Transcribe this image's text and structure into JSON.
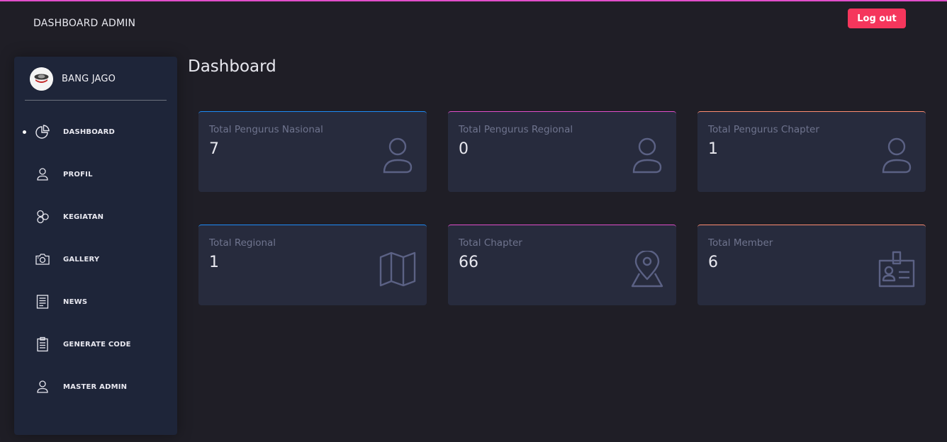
{
  "header": {
    "brand": "DASHBOARD ADMIN",
    "logout_label": "Log out",
    "accent_color": "#e14eca",
    "logout_color": "#f5365c"
  },
  "sidebar": {
    "username": "BANG JAGO",
    "items": [
      {
        "label": "DASHBOARD",
        "icon": "pie-chart-icon",
        "active": true
      },
      {
        "label": "PROFIL",
        "icon": "user-icon",
        "active": false
      },
      {
        "label": "KEGIATAN",
        "icon": "atom-icon",
        "active": false
      },
      {
        "label": "GALLERY",
        "icon": "camera-icon",
        "active": false
      },
      {
        "label": "NEWS",
        "icon": "document-icon",
        "active": false
      },
      {
        "label": "GENERATE CODE",
        "icon": "clipboard-icon",
        "active": false
      },
      {
        "label": "MASTER ADMIN",
        "icon": "user-icon",
        "active": false
      }
    ]
  },
  "main": {
    "title": "Dashboard",
    "cards": [
      {
        "title": "Total Pengurus Nasional",
        "value": "7",
        "icon": "user-icon",
        "accent": "#1d8cf8"
      },
      {
        "title": "Total Pengurus Regional",
        "value": "0",
        "icon": "user-icon",
        "accent": "#e14eca"
      },
      {
        "title": "Total Pengurus Chapter",
        "value": "1",
        "icon": "user-icon",
        "accent": "#ff8d72"
      },
      {
        "title": "Total Regional",
        "value": "1",
        "icon": "map-icon",
        "accent": "#1d8cf8"
      },
      {
        "title": "Total Chapter",
        "value": "66",
        "icon": "map-pin-icon",
        "accent": "#e14eca"
      },
      {
        "title": "Total Member",
        "value": "6",
        "icon": "id-badge-icon",
        "accent": "#ff8d72"
      }
    ]
  }
}
